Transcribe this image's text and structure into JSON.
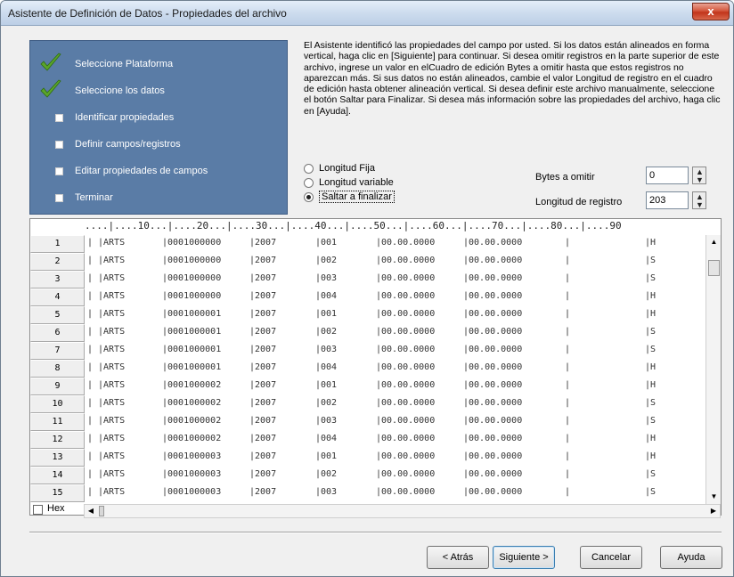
{
  "window": {
    "title": "Asistente de Definición de Datos - Propiedades del archivo",
    "close_label": "x"
  },
  "steps": [
    {
      "label": "Seleccione Plataforma",
      "state": "done"
    },
    {
      "label": "Seleccione los datos",
      "state": "done"
    },
    {
      "label": "Identificar propiedades",
      "state": "pending"
    },
    {
      "label": "Definir campos/registros",
      "state": "pending"
    },
    {
      "label": "Editar propiedades de campos",
      "state": "pending"
    },
    {
      "label": "Terminar",
      "state": "pending"
    }
  ],
  "description": "El Asistente identificó las propiedades del campo por usted. Si los datos están alineados en forma vertical, haga clic en [Siguiente] para continuar. Si desea omitir registros en la parte superior de este archivo, ingrese un valor en elCuadro de edición Bytes a omitir hasta que estos registros no aparezcan más. Si sus datos no están alineados, cambie el valor Longitud de registro en el cuadro de edición hasta obtener alineación vertical. Si desea definir este archivo manualmente, seleccione el botón Saltar para Finalizar. Si desea más información sobre las propiedades del archivo, haga clic en [Ayuda].",
  "options": {
    "radios": [
      {
        "label": "Longitud Fija",
        "selected": false
      },
      {
        "label": "Longitud variable",
        "selected": false
      },
      {
        "label": "Saltar a finalizar",
        "selected": true
      }
    ],
    "bytes_label": "Bytes a omitir",
    "bytes_value": "0",
    "length_label": "Longitud de registro",
    "length_value": "203"
  },
  "grid": {
    "ruler": "....|....10...|....20...|....30...|....40...|....50...|....60...|....70...|....80...|....90",
    "rows": [
      {
        "n": "1",
        "c1": "|ARTS",
        "c2": "|0001000000",
        "c3": "|2007",
        "c4": "|001",
        "c5": "|00.00.0000",
        "c6": "|00.00.0000",
        "c7": "|H"
      },
      {
        "n": "2",
        "c1": "|ARTS",
        "c2": "|0001000000",
        "c3": "|2007",
        "c4": "|002",
        "c5": "|00.00.0000",
        "c6": "|00.00.0000",
        "c7": "|S"
      },
      {
        "n": "3",
        "c1": "|ARTS",
        "c2": "|0001000000",
        "c3": "|2007",
        "c4": "|003",
        "c5": "|00.00.0000",
        "c6": "|00.00.0000",
        "c7": "|S"
      },
      {
        "n": "4",
        "c1": "|ARTS",
        "c2": "|0001000000",
        "c3": "|2007",
        "c4": "|004",
        "c5": "|00.00.0000",
        "c6": "|00.00.0000",
        "c7": "|H"
      },
      {
        "n": "5",
        "c1": "|ARTS",
        "c2": "|0001000001",
        "c3": "|2007",
        "c4": "|001",
        "c5": "|00.00.0000",
        "c6": "|00.00.0000",
        "c7": "|H"
      },
      {
        "n": "6",
        "c1": "|ARTS",
        "c2": "|0001000001",
        "c3": "|2007",
        "c4": "|002",
        "c5": "|00.00.0000",
        "c6": "|00.00.0000",
        "c7": "|S"
      },
      {
        "n": "7",
        "c1": "|ARTS",
        "c2": "|0001000001",
        "c3": "|2007",
        "c4": "|003",
        "c5": "|00.00.0000",
        "c6": "|00.00.0000",
        "c7": "|S"
      },
      {
        "n": "8",
        "c1": "|ARTS",
        "c2": "|0001000001",
        "c3": "|2007",
        "c4": "|004",
        "c5": "|00.00.0000",
        "c6": "|00.00.0000",
        "c7": "|H"
      },
      {
        "n": "9",
        "c1": "|ARTS",
        "c2": "|0001000002",
        "c3": "|2007",
        "c4": "|001",
        "c5": "|00.00.0000",
        "c6": "|00.00.0000",
        "c7": "|H"
      },
      {
        "n": "10",
        "c1": "|ARTS",
        "c2": "|0001000002",
        "c3": "|2007",
        "c4": "|002",
        "c5": "|00.00.0000",
        "c6": "|00.00.0000",
        "c7": "|S"
      },
      {
        "n": "11",
        "c1": "|ARTS",
        "c2": "|0001000002",
        "c3": "|2007",
        "c4": "|003",
        "c5": "|00.00.0000",
        "c6": "|00.00.0000",
        "c7": "|S"
      },
      {
        "n": "12",
        "c1": "|ARTS",
        "c2": "|0001000002",
        "c3": "|2007",
        "c4": "|004",
        "c5": "|00.00.0000",
        "c6": "|00.00.0000",
        "c7": "|H"
      },
      {
        "n": "13",
        "c1": "|ARTS",
        "c2": "|0001000003",
        "c3": "|2007",
        "c4": "|001",
        "c5": "|00.00.0000",
        "c6": "|00.00.0000",
        "c7": "|H"
      },
      {
        "n": "14",
        "c1": "|ARTS",
        "c2": "|0001000003",
        "c3": "|2007",
        "c4": "|002",
        "c5": "|00.00.0000",
        "c6": "|00.00.0000",
        "c7": "|S"
      },
      {
        "n": "15",
        "c1": "|ARTS",
        "c2": "|0001000003",
        "c3": "|2007",
        "c4": "|003",
        "c5": "|00.00.0000",
        "c6": "|00.00.0000",
        "c7": "|S"
      }
    ],
    "hex_label": "Hex"
  },
  "buttons": {
    "back": "< Atrás",
    "next": "Siguiente >",
    "cancel": "Cancelar",
    "help": "Ayuda"
  },
  "colors": {
    "step_panel": "#5a7ca6",
    "check_green": "#5aa52a"
  }
}
